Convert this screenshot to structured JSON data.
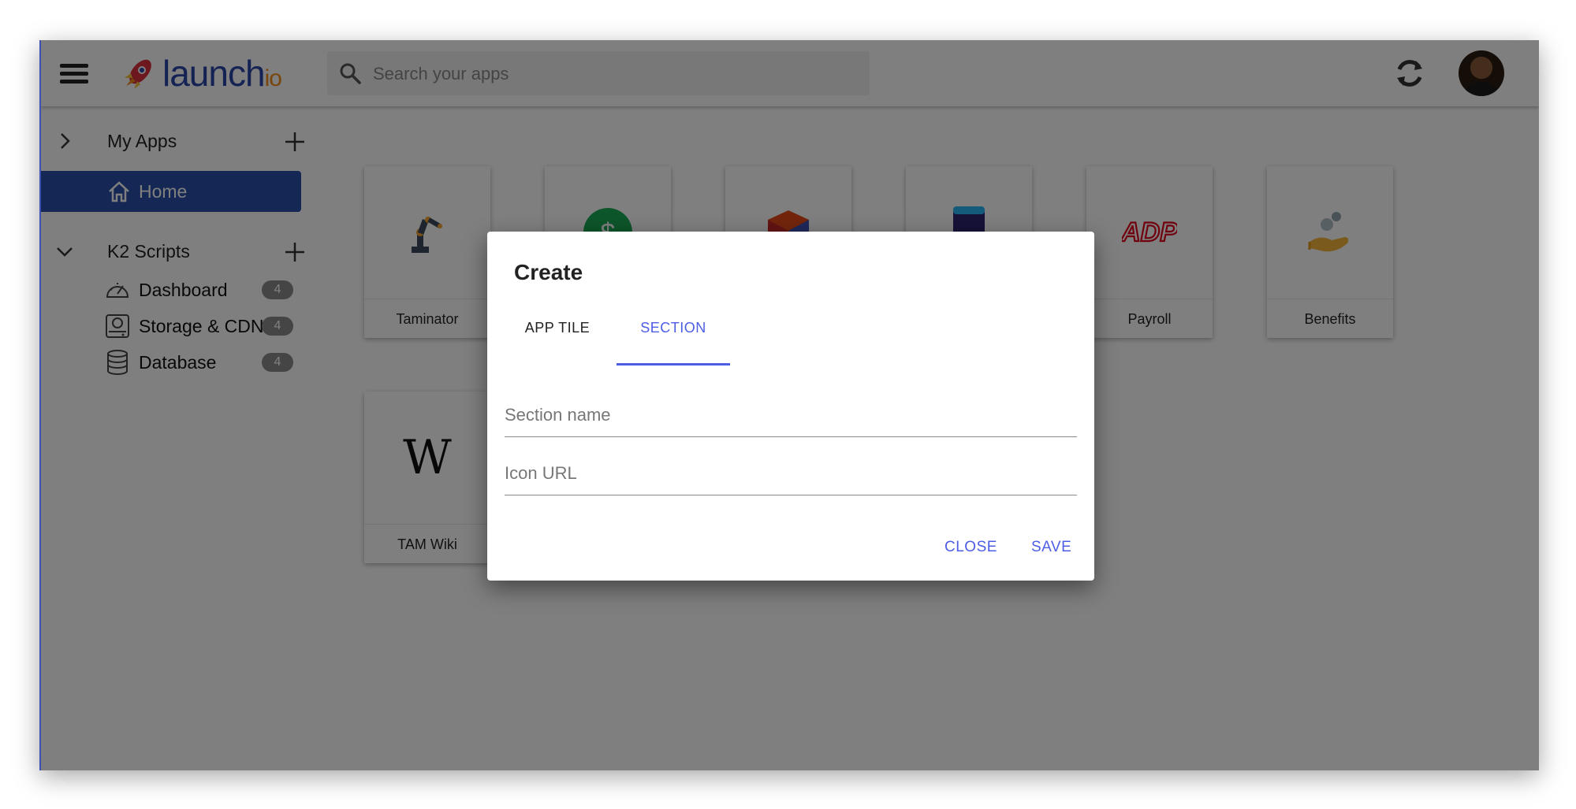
{
  "header": {
    "logo_main": "launch",
    "logo_suffix": "io",
    "search_placeholder": "Search your apps"
  },
  "sidebar": {
    "my_apps": {
      "title": "My Apps",
      "items": [
        {
          "label": "Home",
          "icon": "home-icon"
        }
      ]
    },
    "k2_scripts": {
      "title": "K2 Scripts",
      "items": [
        {
          "label": "Dashboard",
          "icon": "speedometer-icon",
          "count": "4"
        },
        {
          "label": "Storage & CDN",
          "icon": "hard-drive-icon",
          "count": "4"
        },
        {
          "label": "Database",
          "icon": "database-icon",
          "count": "4"
        }
      ]
    }
  },
  "tiles": {
    "row1": [
      {
        "label": "Taminator",
        "icon": "robot-arm-icon"
      },
      {
        "label": "",
        "icon": "dollar-coin-icon"
      },
      {
        "label": "",
        "icon": "office-cube-icon"
      },
      {
        "label": "",
        "icon": "phone-icon"
      },
      {
        "label": "Payroll",
        "icon": "adp-logo-icon"
      },
      {
        "label": "Benefits",
        "icon": "hand-coins-icon"
      }
    ],
    "row2": [
      {
        "label": "TAM Wiki",
        "icon": "wikipedia-icon",
        "glyph": "W"
      }
    ]
  },
  "dialog": {
    "title": "Create",
    "tabs": [
      "APP TILE",
      "SECTION"
    ],
    "active_tab": "SECTION",
    "section_name_placeholder": "Section name",
    "icon_url_placeholder": "Icon URL",
    "close_label": "CLOSE",
    "save_label": "SAVE"
  },
  "colors": {
    "brand_blue": "#2b4fa8",
    "accent": "#4d5ee6",
    "logo_orange": "#f08a17"
  }
}
